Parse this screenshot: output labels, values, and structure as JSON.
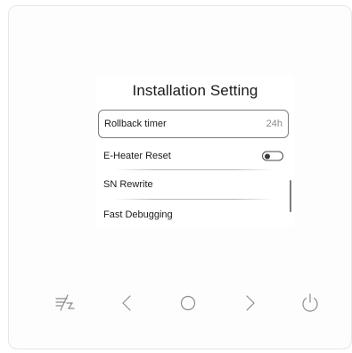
{
  "screen": {
    "title": "Installation Setting",
    "items": [
      {
        "label": "Rollback timer",
        "value": "24h",
        "selected": true
      },
      {
        "label": "E-Heater Reset",
        "toggle": "off"
      },
      {
        "label": "SN Rewrite"
      },
      {
        "label": "Fast Debugging"
      }
    ]
  },
  "buttons": [
    {
      "name": "lock-icon"
    },
    {
      "name": "chevron-left-icon"
    },
    {
      "name": "circle-home-icon"
    },
    {
      "name": "chevron-right-icon"
    },
    {
      "name": "power-icon"
    }
  ],
  "colors": {
    "frame_border": "#e6e6e6",
    "icon_stroke": "#8c8c8c",
    "text": "#1a1a1a",
    "value_text": "#8a8a8a"
  }
}
